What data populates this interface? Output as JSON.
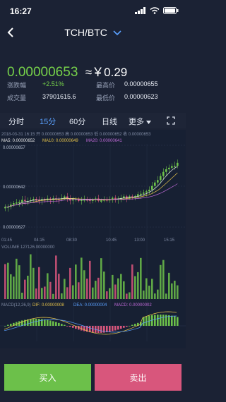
{
  "status": {
    "time": "16:27"
  },
  "nav": {
    "title": "TCH/BTC"
  },
  "price": {
    "last": "0.00000653",
    "cny": "≈￥0.29"
  },
  "stats": {
    "change_label": "涨跌幅",
    "change_value": "+2.51%",
    "volume_label": "成交量",
    "volume_value": "37901615.6",
    "high_label": "最高价",
    "high_value": "0.00000655",
    "low_label": "最低价",
    "low_value": "0.00000623"
  },
  "tabs": [
    "分时",
    "15分",
    "60分",
    "日线",
    "更多"
  ],
  "chart": {
    "info_line": "2018-03-31 16:15  开 0.00000653  高 0.00000653  低 0.00000652  收 0.00000653",
    "ma": {
      "ma5": "MA5: 0.00000652",
      "ma10": "MA10: 0.00000649",
      "ma20": "MA20: 0.00000641"
    },
    "y_labels": [
      "0.00000657",
      "0.00000642",
      "0.00000627"
    ],
    "x_labels": [
      "01:45",
      "04:15",
      "08:30",
      "10:45",
      "13:00",
      "15:15"
    ],
    "volume_label": "VOLUME 127126.00000000",
    "macd": {
      "title": "MACD(12,26,9)",
      "dif": "DIF: 0.00000008",
      "dea": "DEA: 0.00000004",
      "macd": "MACD: 0.00000002"
    }
  },
  "buttons": {
    "buy": "买入",
    "sell": "卖出"
  },
  "colors": {
    "up": "#6cc04a",
    "down": "#d8567c",
    "accent": "#5aa0ff",
    "ma5": "#e8e8e8",
    "ma10": "#e6c34a",
    "ma20": "#c06ad8"
  }
}
